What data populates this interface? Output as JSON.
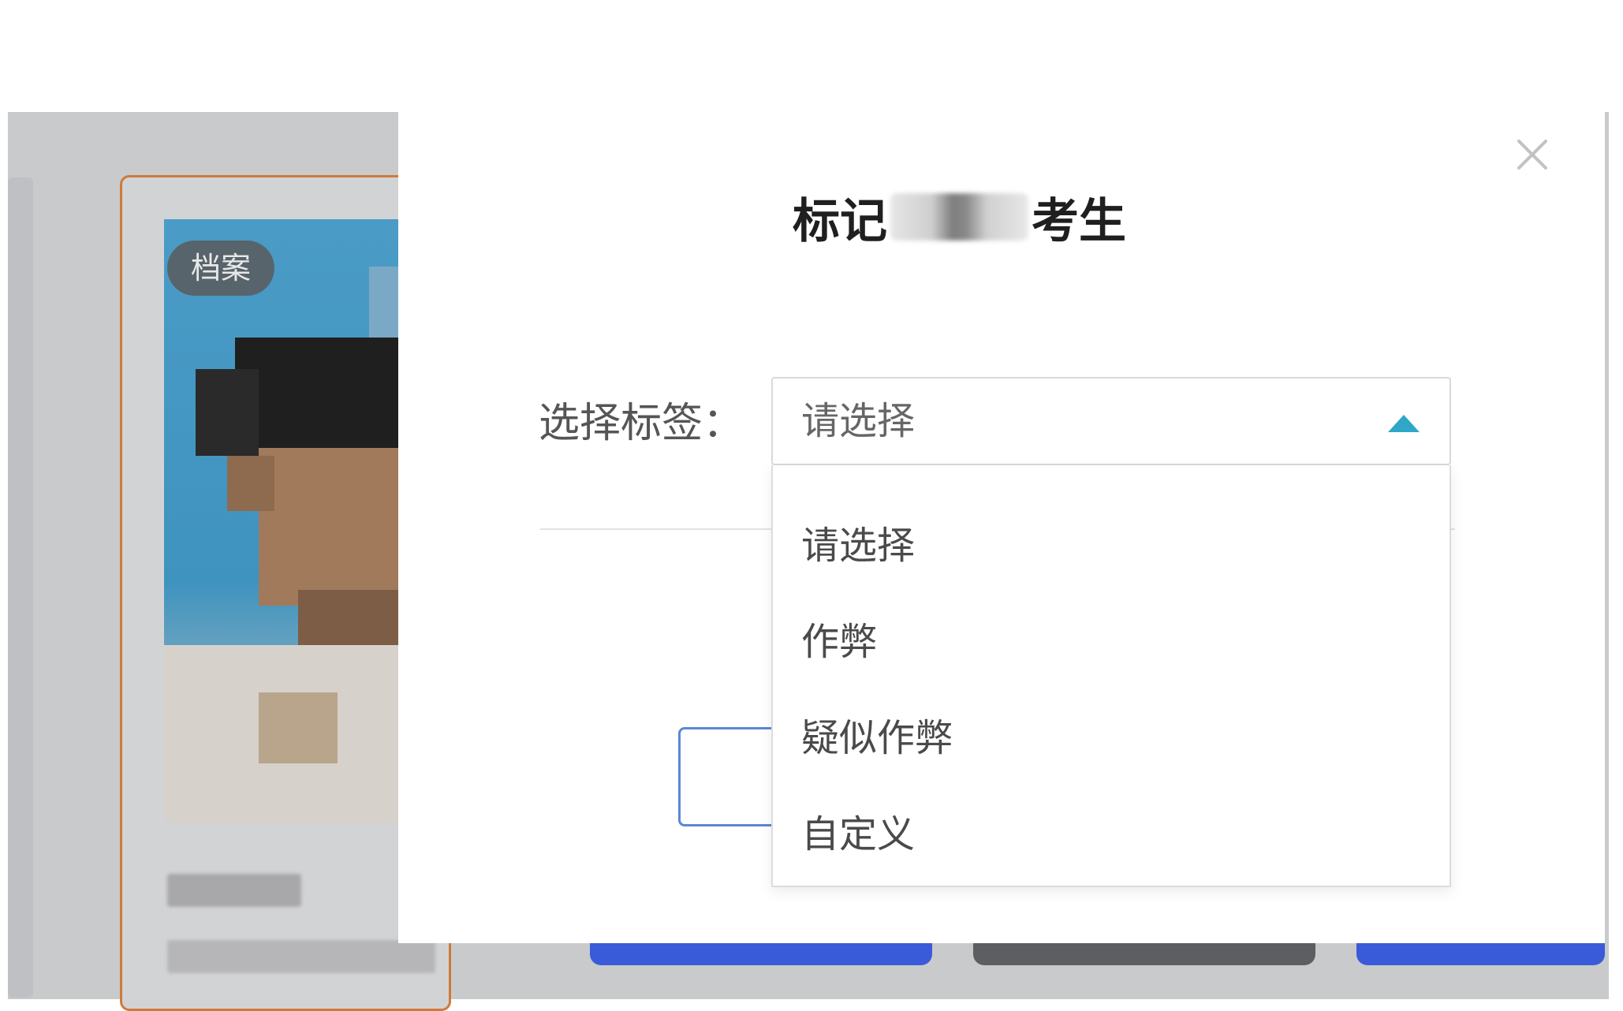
{
  "background": {
    "card_tag": "档案"
  },
  "modal": {
    "title_prefix": "标记",
    "title_suffix": "考生",
    "field_label": "选择标签：",
    "select": {
      "placeholder": "请选择",
      "options": [
        "请选择",
        "作弊",
        "疑似作弊",
        "自定义"
      ]
    }
  },
  "colors": {
    "caret": "#2ea7c9",
    "card_border": "#cf7a3b",
    "primary_button": "#3a5bd9",
    "dark_button": "#5d5e61"
  }
}
